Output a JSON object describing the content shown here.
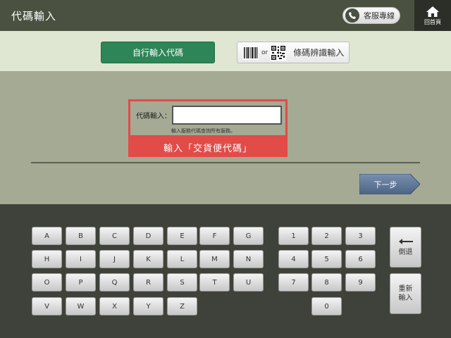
{
  "header": {
    "title": "代碼輸入",
    "service_label": "客服專線",
    "home_label": "回首頁"
  },
  "mode": {
    "code_label": "自行輸入代碼",
    "or_text": "or",
    "barcode_label": "條碼辨識輸入"
  },
  "form": {
    "code_label": "代碼輸入：",
    "code_value": "",
    "hint": "輸入服務代碼查詢所有服務。",
    "caption": "輸入「交貨便代碼」",
    "next_label": "下一步"
  },
  "keyboard": {
    "letters": [
      [
        "A",
        "B",
        "C",
        "D",
        "E",
        "F",
        "G"
      ],
      [
        "H",
        "I",
        "J",
        "K",
        "L",
        "M",
        "N"
      ],
      [
        "O",
        "P",
        "Q",
        "R",
        "S",
        "T",
        "U"
      ],
      [
        "V",
        "W",
        "X",
        "Y",
        "Z"
      ]
    ],
    "digits": [
      [
        "1",
        "2",
        "3"
      ],
      [
        "4",
        "5",
        "6"
      ],
      [
        "7",
        "8",
        "9"
      ],
      [
        "0"
      ]
    ],
    "backspace_label": "倒退",
    "reset_label_line1": "重新",
    "reset_label_line2": "輸入"
  },
  "colors": {
    "accent_green": "#2e8557",
    "highlight_red": "#e14b48",
    "next_blue": "#5f7695"
  }
}
